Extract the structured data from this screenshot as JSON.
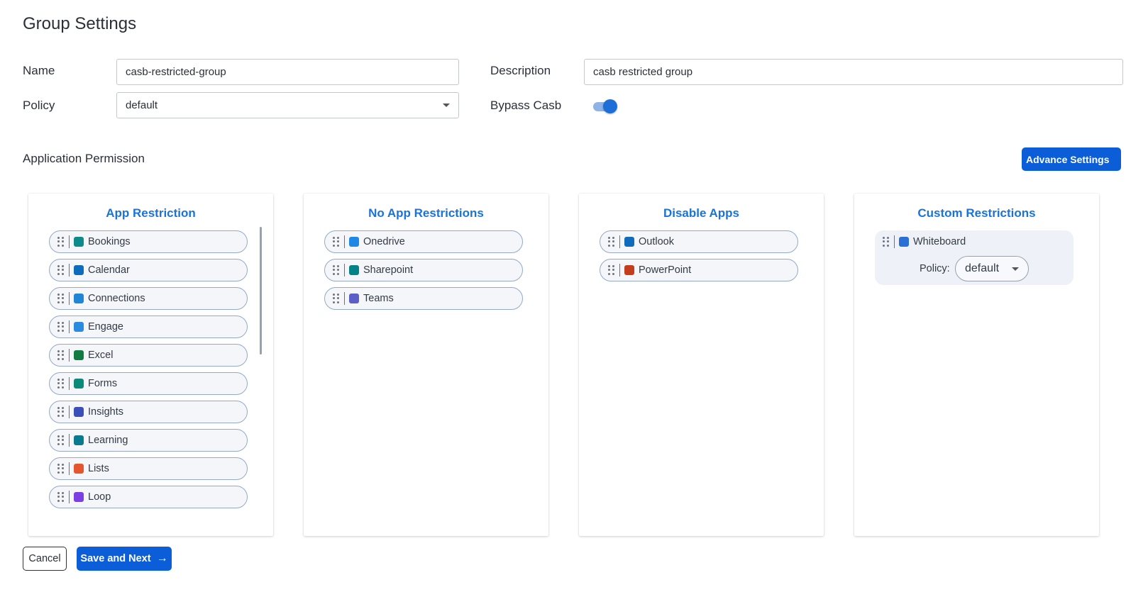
{
  "page": {
    "title": "Group Settings"
  },
  "form": {
    "name_label": "Name",
    "name_value": "casb-restricted-group",
    "description_label": "Description",
    "description_value": "casb restricted group",
    "policy_label": "Policy",
    "policy_value": "default",
    "bypass_label": "Bypass Casb",
    "bypass_enabled": true
  },
  "application_permission": {
    "title": "Application Permission",
    "advance_settings_label": "Advance Settings"
  },
  "columns": [
    {
      "title": "App Restriction",
      "apps": [
        {
          "label": "Bookings",
          "icon": "bookings-icon",
          "color": "#0f8a8a"
        },
        {
          "label": "Calendar",
          "icon": "calendar-icon",
          "color": "#0f6cbd"
        },
        {
          "label": "Connections",
          "icon": "connections-icon",
          "color": "#1f86d6"
        },
        {
          "label": "Engage",
          "icon": "engage-icon",
          "color": "#2a8be0"
        },
        {
          "label": "Excel",
          "icon": "excel-icon",
          "color": "#107c41"
        },
        {
          "label": "Forms",
          "icon": "forms-icon",
          "color": "#0b8a7a"
        },
        {
          "label": "Insights",
          "icon": "insights-icon",
          "color": "#3a4fb8"
        },
        {
          "label": "Learning",
          "icon": "learning-icon",
          "color": "#0a7a8f"
        },
        {
          "label": "Lists",
          "icon": "lists-icon",
          "color": "#e4572e"
        },
        {
          "label": "Loop",
          "icon": "loop-icon",
          "color": "#7b3fe4"
        }
      ]
    },
    {
      "title": "No App Restrictions",
      "apps": [
        {
          "label": "Onedrive",
          "icon": "onedrive-icon",
          "color": "#1e88e5"
        },
        {
          "label": "Sharepoint",
          "icon": "sharepoint-icon",
          "color": "#038387"
        },
        {
          "label": "Teams",
          "icon": "teams-icon",
          "color": "#5b5fc7"
        }
      ]
    },
    {
      "title": "Disable Apps",
      "apps": [
        {
          "label": "Outlook",
          "icon": "outlook-icon",
          "color": "#0f6cbd"
        },
        {
          "label": "PowerPoint",
          "icon": "powerpoint-icon",
          "color": "#c43e1c"
        }
      ]
    },
    {
      "title": "Custom Restrictions",
      "custom": {
        "label": "Whiteboard",
        "icon": "whiteboard-icon",
        "color": "#2b6fd6",
        "policy_label": "Policy:",
        "policy_value": "default"
      }
    }
  ],
  "footer": {
    "cancel_label": "Cancel",
    "save_label": "Save and Next"
  }
}
